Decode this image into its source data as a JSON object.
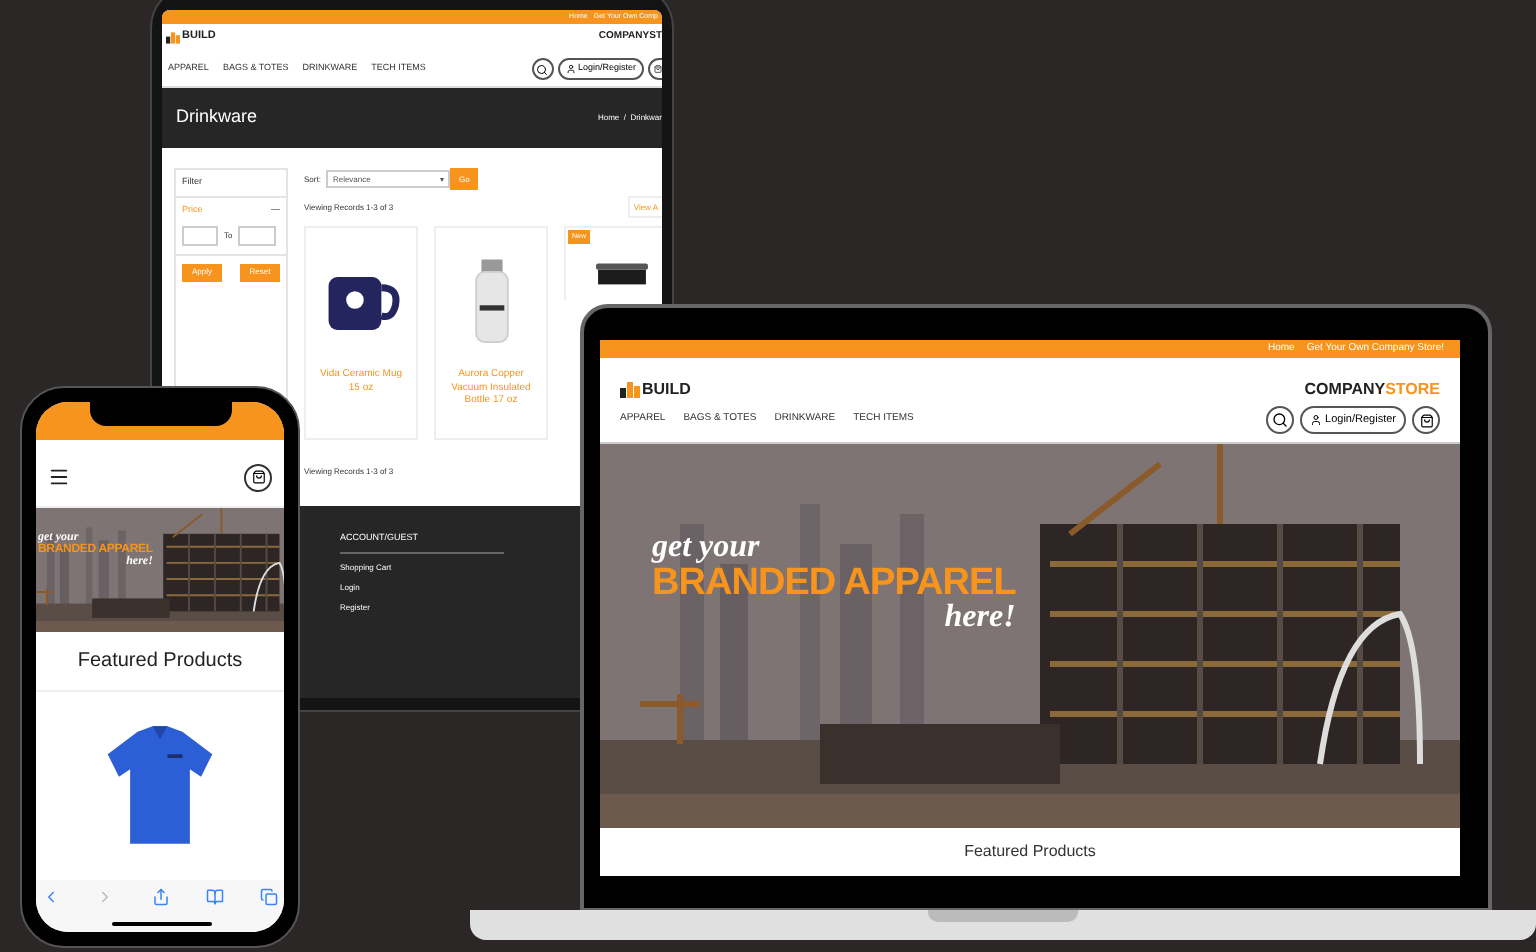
{
  "tablet": {
    "top_links": [
      "Home",
      "Get Your Own Comp"
    ],
    "logo": "BUILD",
    "store_name": "COMPANYST",
    "nav": [
      "APPAREL",
      "BAGS & TOTES",
      "DRINKWARE",
      "TECH ITEMS"
    ],
    "login": "Login/Register",
    "page_title": "Drinkware",
    "breadcrumb": "Home  /  Drinkwar",
    "filter": {
      "title": "Filter",
      "price_label": "Price",
      "collapse": "—",
      "to": "To",
      "buttons": [
        "Apply",
        "Reset"
      ]
    },
    "sort": {
      "label": "Sort:",
      "value": "Relevance",
      "go": "Go"
    },
    "records": "Viewing Records 1-3 of 3",
    "view_all": "View A",
    "products": [
      {
        "name": "Vida Ceramic Mug 15 oz"
      },
      {
        "name": "Aurora Copper Vacuum Insulated Bottle 17 oz"
      },
      {
        "badge": "New"
      }
    ],
    "records_bottom": "Viewing Records 1-3 of 3",
    "footer": {
      "heading": "ACCOUNT/GUEST",
      "links": [
        "Shopping Cart",
        "Login",
        "Register"
      ]
    }
  },
  "laptop": {
    "top_links": [
      "Home",
      "Get Your Own Company Store!"
    ],
    "logo": "BUILD",
    "store_name": [
      "COMPANY",
      "STORE"
    ],
    "nav": [
      "APPAREL",
      "BAGS & TOTES",
      "DRINKWARE",
      "TECH ITEMS"
    ],
    "login": "Login/Register",
    "hero": [
      "get your",
      "BRANDED APPAREL",
      "here!"
    ],
    "section_title": "Featured Products"
  },
  "phone": {
    "hero": [
      "get your",
      "BRANDED APPAREL",
      "here!"
    ],
    "section_title": "Featured Products"
  }
}
